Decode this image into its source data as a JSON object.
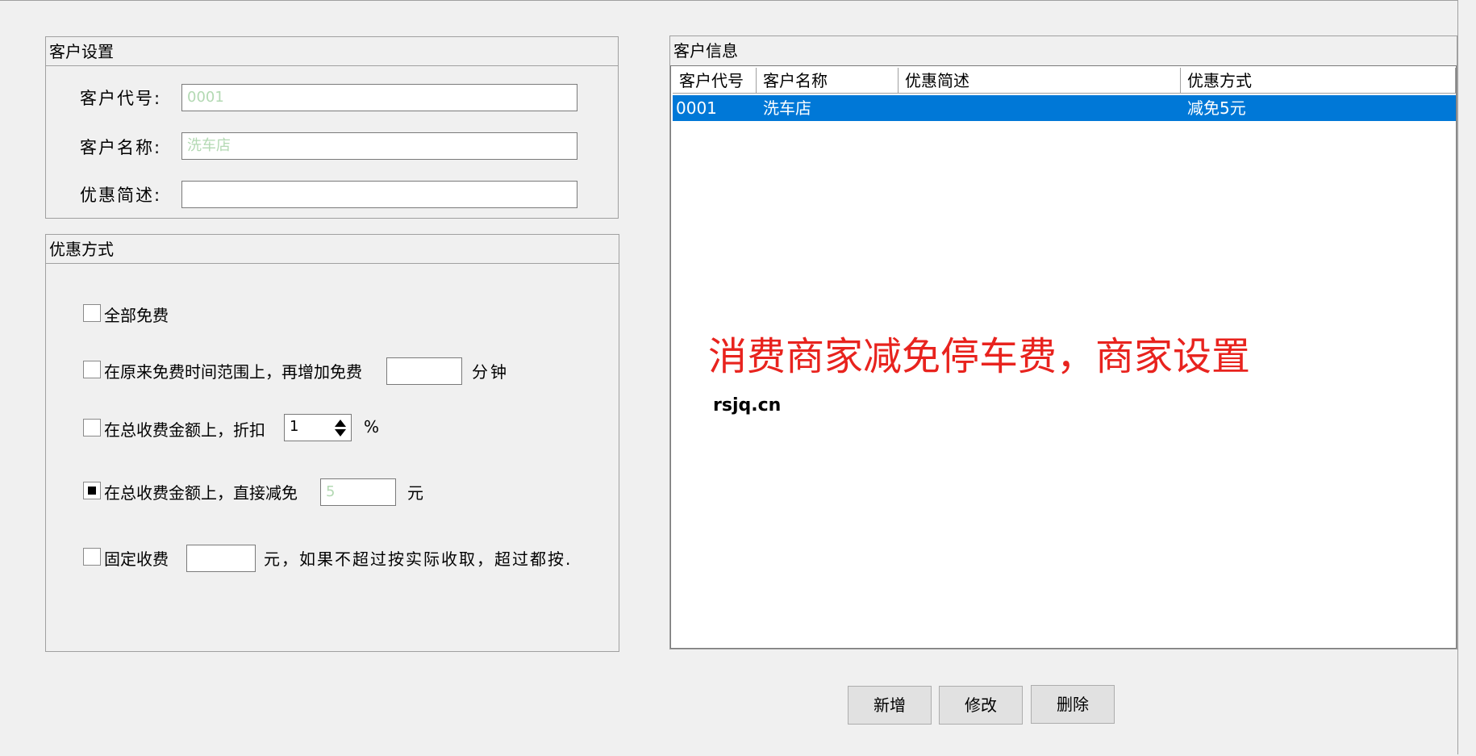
{
  "customer_settings": {
    "title": "客户设置",
    "code_label": "客户代号:",
    "code_value": "0001",
    "name_label": "客户名称:",
    "name_value": "洗车店",
    "desc_label": "优惠简述:",
    "desc_value": ""
  },
  "discount_method": {
    "title": "优惠方式",
    "options": [
      {
        "label": "全部免费",
        "checked": false
      },
      {
        "label": "在原来免费时间范围上，再增加免费",
        "suffix": "分钟",
        "value": "",
        "checked": false
      },
      {
        "label": "在总收费金额上，折扣",
        "suffix": "%",
        "value": "1",
        "checked": false
      },
      {
        "label": "在总收费金额上，直接减免",
        "suffix": "元",
        "value": "5",
        "checked": true
      },
      {
        "label": "固定收费",
        "suffix": "元，如果不超过按实际收取，超过都按.",
        "value": "",
        "checked": false
      }
    ]
  },
  "customer_info": {
    "title": "客户信息",
    "columns": [
      "客户代号",
      "客户名称",
      "优惠简述",
      "优惠方式"
    ],
    "rows": [
      {
        "code": "0001",
        "name": "洗车店",
        "desc": "",
        "method": "减免5元"
      }
    ]
  },
  "overlay": {
    "caption": "消费商家减免停车费，商家设置",
    "url": "rsjq.cn",
    "caption_color": "#e8231e"
  },
  "buttons": {
    "add": "新增",
    "edit": "修改",
    "delete": "删除"
  },
  "colors": {
    "selection": "#0078d7",
    "background": "#f0f0f0"
  }
}
